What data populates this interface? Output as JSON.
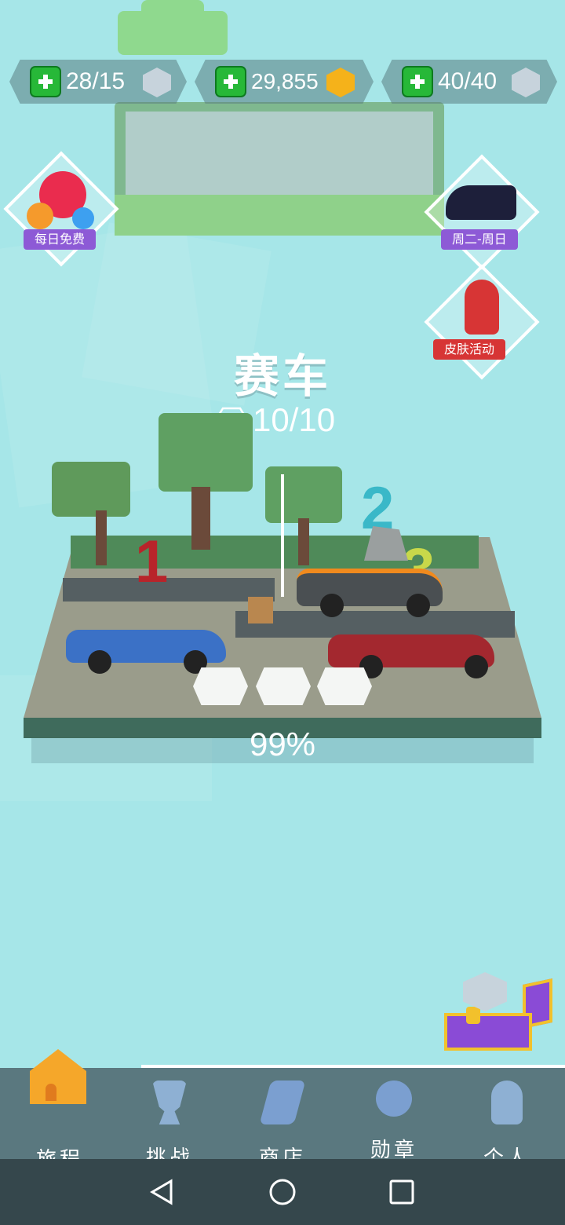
{
  "resources": [
    {
      "value": "28/15",
      "icon": "stone-cube-icon"
    },
    {
      "value": "29,855",
      "icon": "gold-cube-icon"
    },
    {
      "value": "40/40",
      "icon": "heart-cube-icon"
    }
  ],
  "events": {
    "daily_free": "每日免费",
    "weekly": "周二-周日",
    "skin_event": "皮肤活动"
  },
  "level": {
    "title": "赛车",
    "gems": "10/10",
    "percent": "99%",
    "numerals": [
      "1",
      "2",
      "3"
    ]
  },
  "nav": {
    "journey": "旅程",
    "challenge": "挑战",
    "shop": "商店",
    "medal": "勋章",
    "profile": "个人"
  },
  "colors": {
    "background": "#a6e6e8",
    "plus": "#27b838",
    "gold": "#f5b21a",
    "tag_purple": "#8d5ad6",
    "tag_red": "#d73535"
  }
}
